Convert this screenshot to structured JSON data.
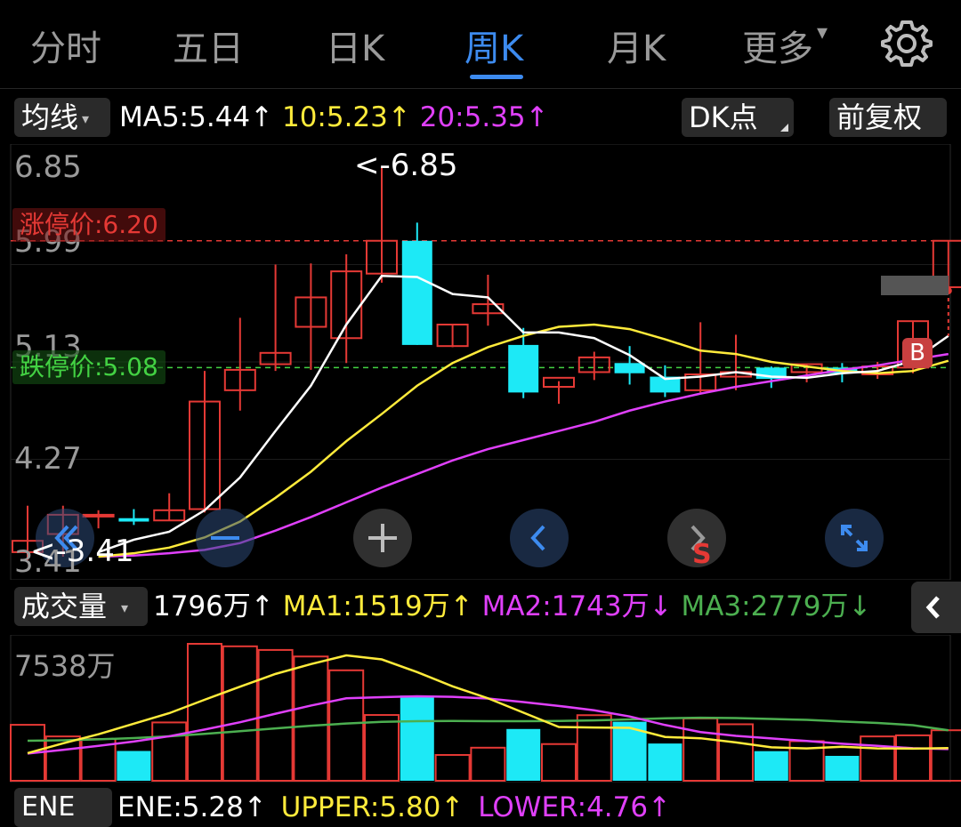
{
  "tabs": [
    "分时",
    "五日",
    "日K",
    "周K",
    "月K",
    "更多"
  ],
  "active_tab": "周K",
  "more_caret": "▾",
  "indicator": {
    "label": "均线",
    "arrow": "▾"
  },
  "ma_legend": {
    "ma5": "MA5:5.44↑",
    "ma10": "10:5.23↑",
    "ma20": "20:5.35↑"
  },
  "dk_button": "DK点",
  "fq_button": "前复权",
  "price_axis": [
    "6.85",
    "5.99",
    "5.13",
    "4.27",
    "3.41"
  ],
  "limit_up": "涨停价:6.20",
  "limit_down": "跌停价:5.08",
  "high_annot": "<-6.85",
  "low_annot": "<-3.41",
  "marker_b": "B",
  "marker_s": "S",
  "volume_indicator": {
    "label": "成交量",
    "arrow": "▾"
  },
  "vol_legend": {
    "vol": "1796万↑",
    "ma1": "MA1:1519万↑",
    "ma2": "MA2:1743万↓",
    "ma3": "MA3:2779万↓"
  },
  "vol_axis_top": "7538万",
  "bottom_legend": {
    "label": "ENE",
    "ene": "ENE:5.28↑",
    "upper": "UPPER:5.80↑",
    "lower": "LOWER:4.76↑"
  },
  "colors": {
    "up": "#e53935",
    "down": "#1de9f6",
    "ma5": "#ffffff",
    "ma10": "#ffeb3b",
    "ma20": "#e040fb",
    "ma3": "#4caf50",
    "accent": "#3d8bef"
  },
  "icons": [
    "gear-icon",
    "double-left-arrow-icon",
    "minus-icon",
    "plus-icon",
    "chevron-left-icon",
    "chevron-right-icon",
    "expand-icon",
    "side-chevron-left-icon"
  ],
  "chart_data": {
    "type": "candlestick",
    "period": "weekly",
    "ylim": [
      3.41,
      6.85
    ],
    "candles": [
      {
        "o": 3.45,
        "h": 3.86,
        "l": 3.38,
        "c": 3.55,
        "dir": "up"
      },
      {
        "o": 3.61,
        "h": 3.86,
        "l": 3.41,
        "c": 3.78,
        "dir": "up"
      },
      {
        "o": 3.78,
        "h": 3.82,
        "l": 3.66,
        "c": 3.77,
        "dir": "up"
      },
      {
        "o": 3.72,
        "h": 3.83,
        "l": 3.69,
        "c": 3.75,
        "dir": "down"
      },
      {
        "o": 3.73,
        "h": 3.97,
        "l": 3.73,
        "c": 3.82,
        "dir": "up"
      },
      {
        "o": 3.83,
        "h": 5.05,
        "l": 3.8,
        "c": 4.78,
        "dir": "up"
      },
      {
        "o": 4.88,
        "h": 5.52,
        "l": 4.7,
        "c": 5.06,
        "dir": "up"
      },
      {
        "o": 5.11,
        "h": 5.99,
        "l": 5.05,
        "c": 5.21,
        "dir": "up"
      },
      {
        "o": 5.44,
        "h": 6.0,
        "l": 5.06,
        "c": 5.7,
        "dir": "up"
      },
      {
        "o": 5.93,
        "h": 6.08,
        "l": 5.12,
        "c": 5.34,
        "dir": "up"
      },
      {
        "o": 5.91,
        "h": 6.85,
        "l": 5.83,
        "c": 6.2,
        "dir": "up"
      },
      {
        "o": 6.2,
        "h": 6.36,
        "l": 5.28,
        "c": 5.28,
        "dir": "down"
      },
      {
        "o": 5.27,
        "h": 5.46,
        "l": 5.26,
        "c": 5.46,
        "dir": "up"
      },
      {
        "o": 5.56,
        "h": 5.9,
        "l": 5.45,
        "c": 5.64,
        "dir": "up"
      },
      {
        "o": 5.28,
        "h": 5.43,
        "l": 4.81,
        "c": 4.86,
        "dir": "down"
      },
      {
        "o": 4.91,
        "h": 4.96,
        "l": 4.76,
        "c": 4.99,
        "dir": "up"
      },
      {
        "o": 5.04,
        "h": 5.22,
        "l": 4.97,
        "c": 5.17,
        "dir": "up"
      },
      {
        "o": 5.12,
        "h": 5.27,
        "l": 4.93,
        "c": 5.03,
        "dir": "down"
      },
      {
        "o": 5.0,
        "h": 5.1,
        "l": 4.82,
        "c": 4.86,
        "dir": "down"
      },
      {
        "o": 4.88,
        "h": 5.48,
        "l": 4.86,
        "c": 5.02,
        "dir": "up"
      },
      {
        "o": 5.0,
        "h": 5.37,
        "l": 4.88,
        "c": 5.04,
        "dir": "up"
      },
      {
        "o": 5.08,
        "h": 5.09,
        "l": 4.9,
        "c": 4.98,
        "dir": "down"
      },
      {
        "o": 5.04,
        "h": 5.11,
        "l": 4.95,
        "c": 5.11,
        "dir": "up"
      },
      {
        "o": 5.08,
        "h": 5.12,
        "l": 4.95,
        "c": 5.03,
        "dir": "down"
      },
      {
        "o": 5.02,
        "h": 5.13,
        "l": 4.98,
        "c": 5.09,
        "dir": "up"
      },
      {
        "o": 5.08,
        "h": 5.49,
        "l": 5.03,
        "c": 5.49,
        "dir": "up"
      },
      {
        "o": 5.79,
        "h": 6.2,
        "l": 5.79,
        "c": 6.2,
        "dir": "up"
      }
    ],
    "ma5": [
      null,
      null,
      3.45,
      3.56,
      3.63,
      3.82,
      4.11,
      4.52,
      4.92,
      5.46,
      5.89,
      5.88,
      5.73,
      5.7,
      5.39,
      5.39,
      5.34,
      5.19,
      4.98,
      5.0,
      5.04,
      5.0,
      4.99,
      5.03,
      5.05,
      5.14,
      5.36
    ],
    "ma10": [
      null,
      null,
      3.41,
      3.44,
      3.49,
      3.58,
      3.72,
      3.93,
      4.16,
      4.43,
      4.67,
      4.92,
      5.12,
      5.26,
      5.36,
      5.44,
      5.46,
      5.42,
      5.33,
      5.23,
      5.2,
      5.13,
      5.09,
      5.05,
      5.03,
      5.05,
      5.14
    ],
    "ma20": [
      null,
      null,
      3.41,
      3.42,
      3.44,
      3.47,
      3.53,
      3.64,
      3.76,
      3.89,
      4.02,
      4.14,
      4.26,
      4.36,
      4.44,
      4.52,
      4.6,
      4.7,
      4.78,
      4.85,
      4.91,
      4.96,
      5.01,
      5.06,
      5.1,
      5.15,
      5.2
    ],
    "volumes": [
      3080,
      2440,
      2300,
      1640,
      3210,
      7538,
      7400,
      7200,
      6840,
      6080,
      3620,
      4690,
      1420,
      1820,
      2850,
      2020,
      3610,
      3250,
      2050,
      3430,
      3110,
      1630,
      2180,
      1370,
      2440,
      2500,
      2780
    ],
    "vol_ylim": [
      0,
      7538
    ],
    "vol_ma1": [
      1519,
      2060,
      2560,
      3140,
      3720,
      4460,
      5180,
      5880,
      6420,
      6900,
      6680,
      5980,
      5200,
      4540,
      3750,
      2960,
      2930,
      2910,
      2410,
      2340,
      2110,
      1840,
      1780,
      1870,
      1780,
      1770,
      1800
    ],
    "vol_ma2": [
      1500,
      1700,
      1920,
      2160,
      2450,
      2820,
      3220,
      3690,
      4140,
      4540,
      4600,
      4650,
      4620,
      4530,
      4330,
      4120,
      3880,
      3540,
      3070,
      2680,
      2470,
      2330,
      2190,
      2040,
      1920,
      1790,
      1743
    ],
    "vol_ma3": [
      2200,
      2230,
      2280,
      2350,
      2450,
      2580,
      2730,
      2880,
      3030,
      3150,
      3240,
      3280,
      3290,
      3280,
      3280,
      3290,
      3320,
      3380,
      3440,
      3470,
      3450,
      3400,
      3350,
      3260,
      3180,
      3060,
      2779
    ]
  }
}
